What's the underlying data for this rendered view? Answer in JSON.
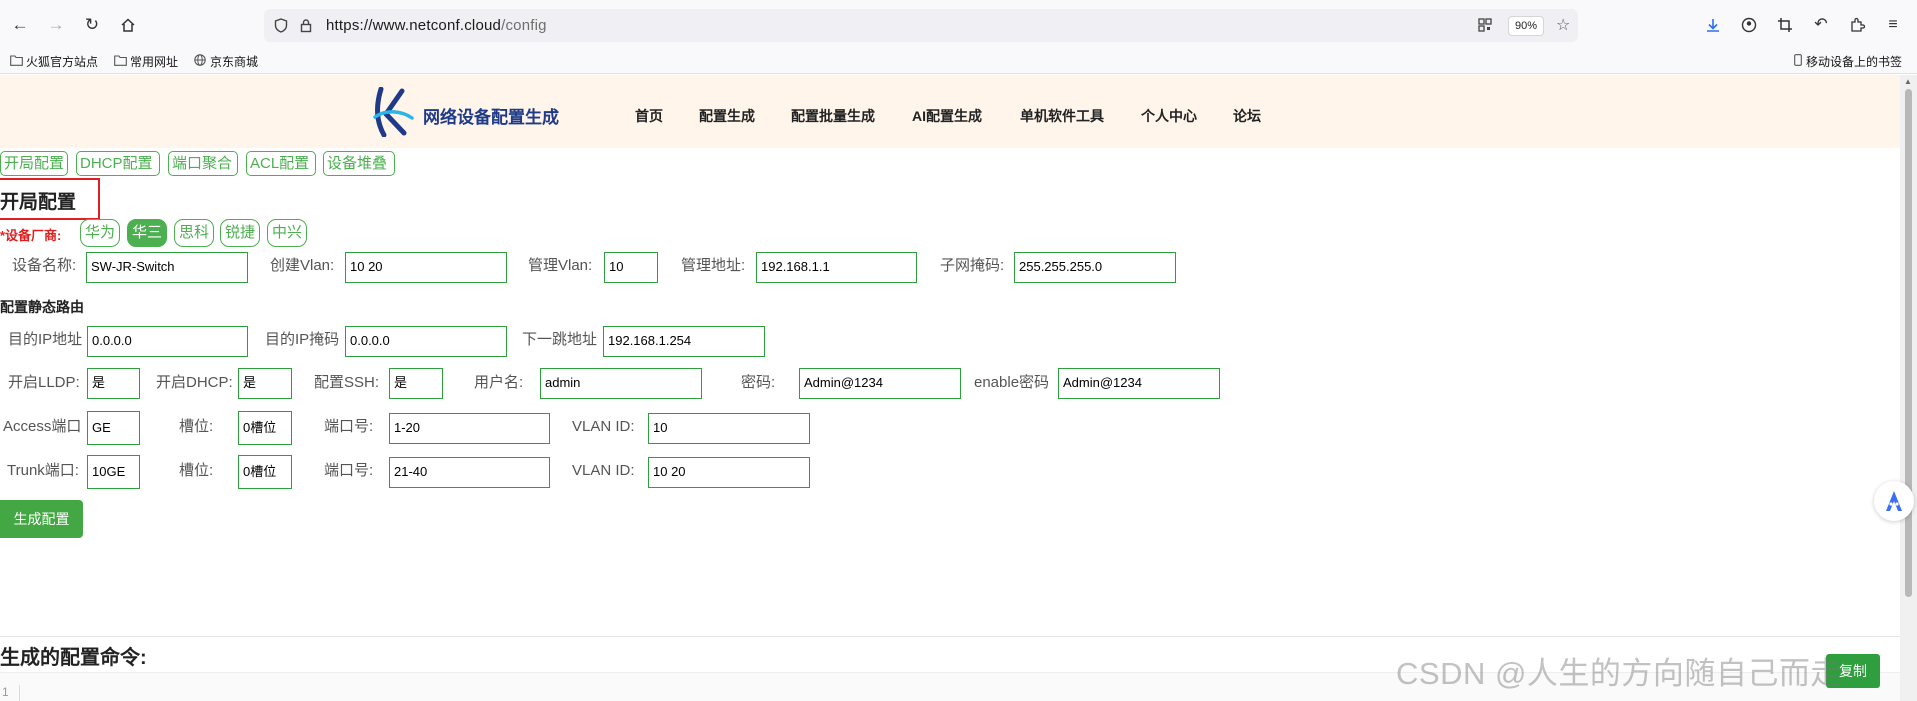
{
  "browser": {
    "url_host": "https://www.netconf.cloud",
    "url_path": "/config",
    "zoom": "90%"
  },
  "bookmarks": [
    {
      "label": "火狐官方站点",
      "icon": "folder-icon"
    },
    {
      "label": "常用网址",
      "icon": "folder-icon"
    },
    {
      "label": "京东商城",
      "icon": "globe-icon"
    }
  ],
  "bookmarks_right": {
    "label": "移动设备上的书签",
    "icon": "mobile-icon"
  },
  "site": {
    "logo_text": "网络设备配置生成",
    "nav": [
      "首页",
      "配置生成",
      "配置批量生成",
      "AI配置生成",
      "单机软件工具",
      "个人中心",
      "论坛"
    ]
  },
  "config_tabs": [
    "开局配置",
    "DHCP配置",
    "端口聚合",
    "ACL配置",
    "设备堆叠"
  ],
  "section_title": "开局配置",
  "vendor": {
    "label": "*设备厂商:",
    "options": [
      "华为",
      "华三",
      "思科",
      "锐捷",
      "中兴"
    ],
    "selected": "华三"
  },
  "basic": {
    "device_name_label": "设备名称:",
    "device_name": "SW-JR-Switch",
    "create_vlan_label": "创建Vlan:",
    "create_vlan": "10 20",
    "mgmt_vlan_label": "管理Vlan:",
    "mgmt_vlan": "10",
    "mgmt_addr_label": "管理地址:",
    "mgmt_addr": "192.168.1.1",
    "subnet_mask_label": "子网掩码:",
    "subnet_mask": "255.255.255.0"
  },
  "static_route": {
    "heading": "配置静态路由",
    "dest_ip_label": "目的IP地址",
    "dest_ip": "0.0.0.0",
    "dest_mask_label": "目的IP掩码",
    "dest_mask": "0.0.0.0",
    "next_hop_label": "下一跳地址",
    "next_hop": "192.168.1.254"
  },
  "services": {
    "lldp_label": "开启LLDP:",
    "lldp": "是",
    "dhcp_label": "开启DHCP:",
    "dhcp": "是",
    "ssh_label": "配置SSH:",
    "ssh": "是",
    "username_label": "用户名:",
    "username": "admin",
    "password_label": "密码:",
    "password": "Admin@1234",
    "enable_label": "enable密码",
    "enable_password": "Admin@1234"
  },
  "access_port": {
    "label": "Access端口",
    "type": "GE",
    "slot_label": "槽位:",
    "slot": "0槽位",
    "port_label": "端口号:",
    "port": "1-20",
    "vlan_label": "VLAN ID:",
    "vlan": "10"
  },
  "trunk_port": {
    "label": "Trunk端口:",
    "type": "10GE",
    "slot_label": "槽位:",
    "slot": "0槽位",
    "port_label": "端口号:",
    "port": "21-40",
    "vlan_label": "VLAN ID:",
    "vlan": "10 20"
  },
  "generate_button": "生成配置",
  "output": {
    "title": "生成的配置命令:",
    "line_number": "1",
    "copy_button": "复制"
  },
  "watermark": "CSDN @人生的方向随自己而走",
  "colors": {
    "accent_green": "#4caf50",
    "header_bg": "#fff5ea",
    "highlight_red": "#e02020",
    "logo_blue": "#1f3a88"
  }
}
